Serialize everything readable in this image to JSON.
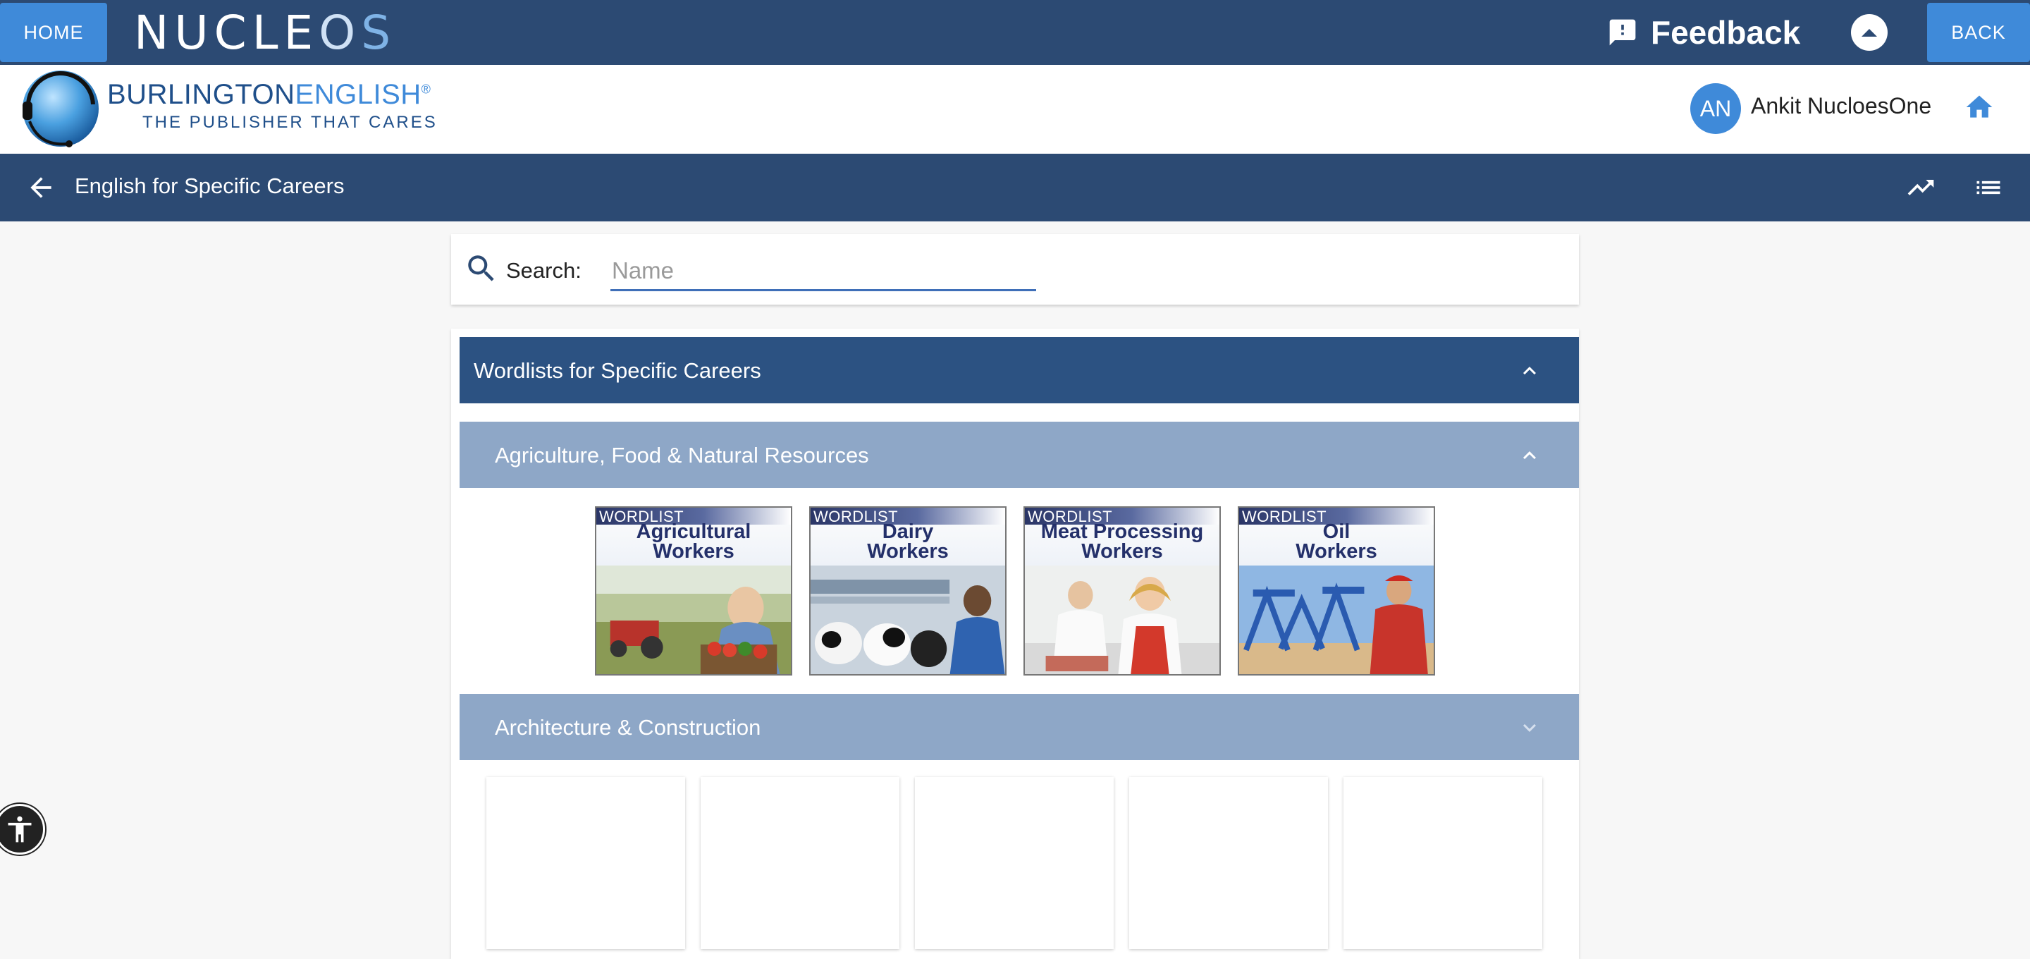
{
  "topbar": {
    "home_label": "HOME",
    "brand_main": "NUCLE",
    "brand_o": "O",
    "brand_s": "S",
    "feedback_label": "Feedback",
    "back_label": "BACK"
  },
  "brand": {
    "name_a": "BURLINGTON",
    "name_b": "ENGLISH",
    "registered": "®",
    "tagline": "THE PUBLISHER THAT CARES"
  },
  "user": {
    "initials": "AN",
    "name": "Ankit NucloesOne"
  },
  "course": {
    "title": "English for Specific Careers"
  },
  "search": {
    "label": "Search:",
    "placeholder": "Name",
    "value": ""
  },
  "section": {
    "title": "Wordlists for Specific Careers",
    "expanded": true
  },
  "categories": [
    {
      "title": "Agriculture, Food & Natural Resources",
      "expanded": true,
      "items": [
        {
          "tag": "WORDLIST",
          "line1": "Agricultural",
          "line2": "Workers"
        },
        {
          "tag": "WORDLIST",
          "line1": "Dairy",
          "line2": "Workers"
        },
        {
          "tag": "WORDLIST",
          "line1": "Meat Processing",
          "line2": "Workers"
        },
        {
          "tag": "WORDLIST",
          "line1": "Oil",
          "line2": "Workers"
        }
      ]
    },
    {
      "title": "Architecture & Construction",
      "expanded": false,
      "placeholder_cards": 5
    }
  ],
  "icons": {
    "feedback": "feedback-icon",
    "scroll_up": "chevron-up-circle-icon",
    "home": "home-icon",
    "back": "arrow-left-icon",
    "progress": "trending-up-icon",
    "menu": "list-icon",
    "search": "search-icon",
    "collapse": "chevron-up-icon",
    "expand": "chevron-down-icon",
    "accessibility": "accessibility-icon"
  },
  "colors": {
    "header_bg": "#2c4a73",
    "accent_button": "#3f8ad9",
    "section_header": "#2c5282",
    "sub_header": "#8ea7c7",
    "page_bg": "#f7f7f7"
  }
}
